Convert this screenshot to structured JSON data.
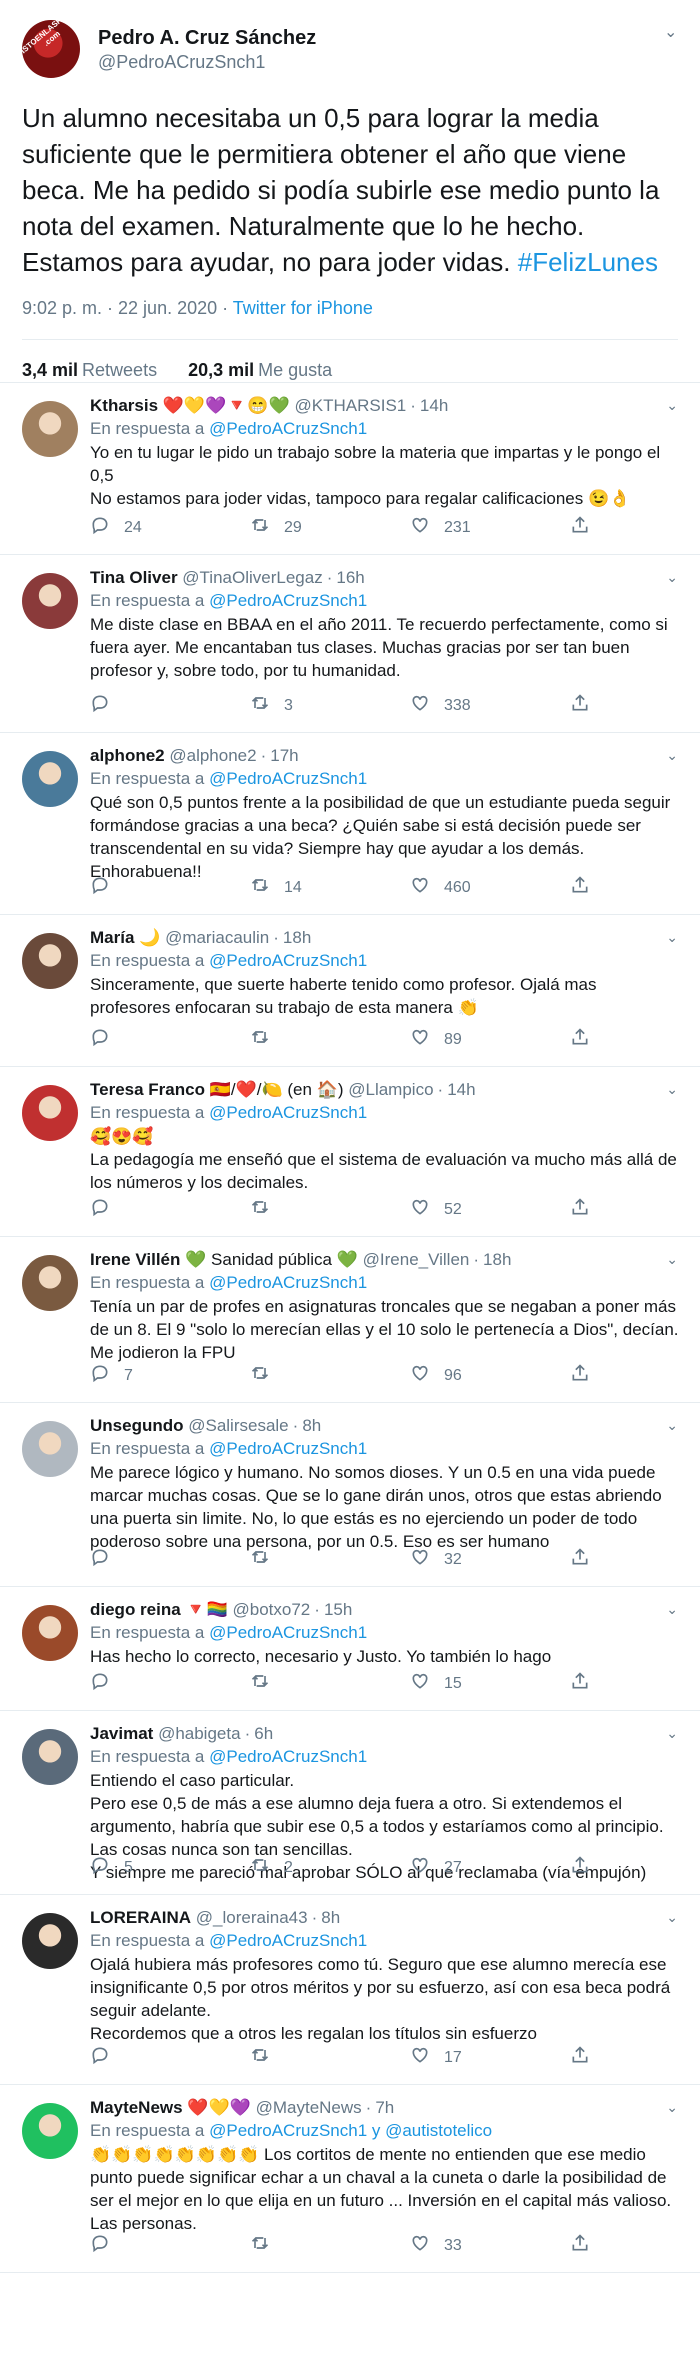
{
  "main": {
    "name": "Pedro A. Cruz Sánchez",
    "handle": "@PedroACruzSnch1",
    "watermark": "VISTOENLASREDES .com",
    "text": "Un alumno necesitaba un 0,5 para lograr la media suficiente que le permitiera obtener el año que viene beca. Me ha pedido si podía subirle ese medio punto la nota del examen. Naturalmente que lo he hecho. Estamos para ayudar, no para joder vidas.",
    "hashtag": "#FelizLunes",
    "time": "9:02 p. m. · 22 jun. 2020 · ",
    "source": "Twitter for iPhone",
    "retweets_count": "3,4 mil",
    "retweets_label": "Retweets",
    "likes_count": "20,3 mil",
    "likes_label": "Me gusta"
  },
  "in_reply_label": "En respuesta a",
  "replies": [
    {
      "name": "Ktharsis",
      "badges": "❤️💛💜🔻😁💚",
      "handle": "@KTHARSIS1",
      "time": "14h",
      "mention": "@PedroACruzSnch1",
      "text": "Yo en tu lugar le pido un trabajo sobre la materia que impartas y le pongo el 0,5\nNo estamos para joder vidas, tampoco para regalar calificaciones 😉👌",
      "replies": "24",
      "retweets": "29",
      "likes": "231"
    },
    {
      "name": "Tina Oliver",
      "badges": "",
      "handle": "@TinaOliverLegaz",
      "time": "16h",
      "mention": "@PedroACruzSnch1",
      "text": "Me diste clase en BBAA en el año 2011. Te recuerdo perfectamente, como si fuera ayer. Me encantaban tus clases. Muchas gracias por ser tan buen profesor y, sobre todo, por tu humanidad.",
      "replies": "",
      "retweets": "3",
      "likes": "338"
    },
    {
      "name": "alphone2",
      "badges": "",
      "handle": "@alphone2",
      "time": "17h",
      "mention": "@PedroACruzSnch1",
      "text": "Qué son 0,5 puntos frente a la posibilidad de que un estudiante pueda seguir formándose gracias a una beca? ¿Quién sabe si está decisión puede ser transcendental en su vida? Siempre hay que ayudar a los demás. Enhorabuena!!",
      "replies": "",
      "retweets": "14",
      "likes": "460"
    },
    {
      "name": "María",
      "badges": "🌙",
      "handle": "@mariacaulin",
      "time": "18h",
      "mention": "@PedroACruzSnch1",
      "text": "Sinceramente, que suerte haberte tenido como profesor. Ojalá mas profesores enfocaran su trabajo de esta manera 👏",
      "replies": "",
      "retweets": "",
      "likes": "89"
    },
    {
      "name": "Teresa Franco",
      "badges": "🇪🇸/❤️/🍋 (en 🏠)",
      "handle": "@Llampico",
      "time": "14h",
      "mention": "@PedroACruzSnch1",
      "text": "🥰😍🥰\nLa pedagogía me enseñó que el sistema de evaluación va mucho más allá de los números y los decimales.",
      "replies": "",
      "retweets": "",
      "likes": "52"
    },
    {
      "name": "Irene Villén",
      "badges": "💚 Sanidad pública 💚",
      "handle": "@Irene_Villen",
      "time": "18h",
      "mention": "@PedroACruzSnch1",
      "text": "Tenía un par de profes en asignaturas troncales que se negaban a poner más de un 8. El 9 \"solo lo merecían ellas y el 10 solo le pertenecía a Dios\", decían. Me jodieron la FPU",
      "replies": "7",
      "retweets": "",
      "likes": "96"
    },
    {
      "name": "Unsegundo",
      "badges": "",
      "handle": "@Salirsesale",
      "time": "8h",
      "mention": "@PedroACruzSnch1",
      "text": "Me parece lógico y humano. No somos dioses. Y un 0.5 en una vida puede marcar muchas cosas. Que se lo gane dirán unos, otros que estas abriendo una puerta sin limite. No, lo que estás es no ejerciendo un poder de todo poderoso sobre una persona, por un 0.5. Eso es ser humano",
      "replies": "",
      "retweets": "",
      "likes": "32"
    },
    {
      "name": "diego reina",
      "badges": "🔻🏳️‍🌈",
      "handle": "@botxo72",
      "time": "15h",
      "mention": "@PedroACruzSnch1",
      "text": "Has hecho lo correcto, necesario y Justo. Yo también lo hago",
      "replies": "",
      "retweets": "",
      "likes": "15"
    },
    {
      "name": "Javimat",
      "badges": "",
      "handle": "@habigeta",
      "time": "6h",
      "mention": "@PedroACruzSnch1",
      "text": "Entiendo el caso particular.\nPero ese 0,5 de más a ese alumno deja fuera a otro. Si extendemos el argumento, habría que subir ese 0,5 a todos y estaríamos como al principio.\nLas cosas nunca son tan sencillas.\nY siempre me pareció mal aprobar SÓLO al que reclamaba (vía empujón)",
      "replies": "5",
      "retweets": "2",
      "likes": "27"
    },
    {
      "name": "LORERAINA",
      "badges": "",
      "handle": "@_loreraina43",
      "time": "8h",
      "mention": "@PedroACruzSnch1",
      "text": "Ojalá hubiera más profesores como tú. Seguro que ese alumno merecía ese insignificante 0,5 por otros méritos y por su esfuerzo, así con esa beca podrá seguir adelante.\nRecordemos que a otros les regalan los títulos sin esfuerzo",
      "replies": "",
      "retweets": "",
      "likes": "17"
    },
    {
      "name": "MayteNews",
      "badges": "❤️💛💜",
      "handle": "@MayteNews",
      "time": "7h",
      "mention": "@PedroACruzSnch1 y @autistotelico",
      "text": "👏👏👏👏👏👏👏👏 Los cortitos de mente no entienden que ese medio punto puede significar echar a un chaval a la cuneta o darle la posibilidad de ser el mejor en lo que elija en un futuro ... Inversión en el capital más valioso. Las personas.",
      "replies": "",
      "retweets": "",
      "likes": "33"
    }
  ]
}
